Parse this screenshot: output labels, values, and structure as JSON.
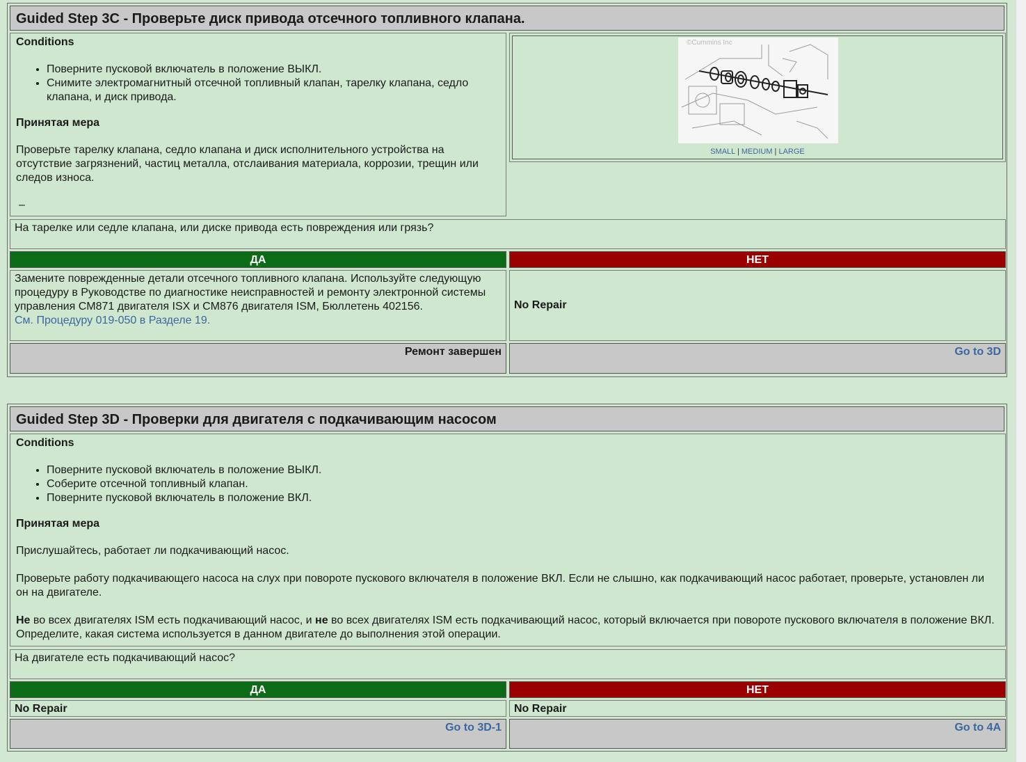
{
  "step_3c": {
    "title": "Guided Step 3C - Проверьте диск привода отсечного топливного клапана.",
    "conditions_label": "Conditions",
    "conditions": [
      "Поверните пусковой включатель в положение ВЫКЛ.",
      "Снимите электромагнитный отсечной топливный клапан, тарелку клапана, седло клапана, и диск привода."
    ],
    "action_label": "Принятая мера",
    "action_text": "Проверьте тарелку клапана, седло клапана и диск исполнительного устройства на отсутствие загрязнений, частиц металла, отслаивания материала, коррозии, трещин или следов износа.",
    "dash": "–",
    "image": {
      "watermark": "©Cummins Inc",
      "size_small": "SMALL",
      "size_medium": "MEDIUM",
      "size_large": "LARGE",
      "separator": "|"
    },
    "question": "На тарелке или седле клапана, или диске привода есть повреждения или грязь?",
    "yes_label": "ДА",
    "no_label": "НЕТ",
    "yes_text": "Замените поврежденные детали отсечного топливного клапана. Используйте следующую процедуру в Руководстве по диагностике неисправностей и ремонту электронной системы управления CM871 двигателя ISX и CM876 двигателя ISM, Бюллетень 402156.",
    "yes_link": "См. Процедуру 019-050 в Разделе 19.",
    "no_text": "No Repair",
    "yes_footer": "Ремонт завершен",
    "no_footer": "Go to 3D"
  },
  "step_3d": {
    "title": "Guided Step 3D - Проверки для двигателя с подкачивающим насосом",
    "conditions_label": "Conditions",
    "conditions": [
      "Поверните пусковой включатель в положение ВЫКЛ.",
      "Соберите отсечной топливный клапан.",
      "Поверните пусковой включатель в положение ВКЛ."
    ],
    "action_label": "Принятая мера",
    "action_p1": "Прислушайтесь, работает ли подкачивающий насос.",
    "action_p2": "Проверьте работу подкачивающего насоса на слух при повороте пускового включателя в положение ВКЛ. Если не слышно, как подкачивающий насос работает, проверьте, установлен ли он на двигателе.",
    "action_p3_b1": "Не",
    "action_p3_t1": " во всех двигателях ISM есть подкачивающий насос, и ",
    "action_p3_b2": "не",
    "action_p3_t2": " во всех двигателях ISM есть подкачивающий насос, который включается при повороте пускового включателя в положение ВКЛ. Определите, какая система используется в данном двигателе до выполнения этой операции.",
    "question": "На двигателе есть подкачивающий насос?",
    "yes_label": "ДА",
    "no_label": "НЕТ",
    "yes_text": "No Repair",
    "no_text": "No Repair",
    "yes_footer": "Go to 3D-1",
    "no_footer": "Go to 4A"
  }
}
